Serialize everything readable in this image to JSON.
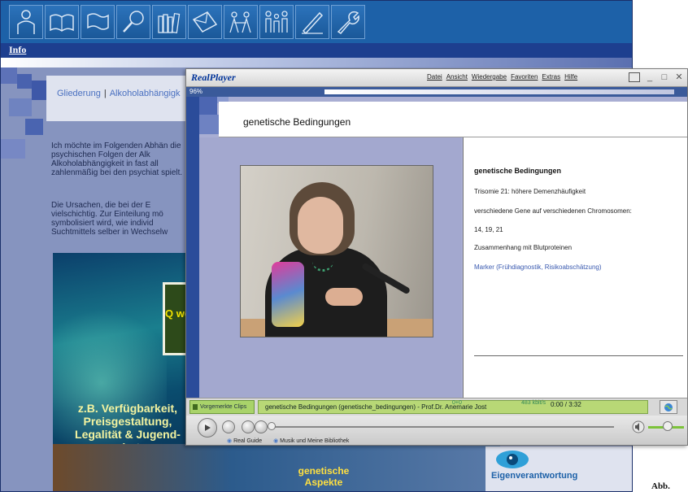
{
  "site": {
    "nav_link": "Info",
    "toolbar_icons": [
      "person-icon",
      "book-icon",
      "flag-icon",
      "magnifier-icon",
      "books-icon",
      "envelope-icon",
      "people-group-icon",
      "family-icon",
      "pen-icon",
      "wrench-icon"
    ],
    "breadcrumb": [
      "Gliederung",
      "Alkoholabhängigk"
    ],
    "paragraph1": "Ich möchte im Folgenden Abhän die psychischen Folgen der Alk Alkoholabhängigkeit in fast all zahlenmäßig bei den psychiat spielt.",
    "paragraph2": "Die Ursachen, die bei der E vielschichtig. Zur Einteilung mö symbolisiert wird, wie individ Suchtmittels selber in Wechselw",
    "image_caption": "z.B. Verfügbarkeit, Preisgestaltung, Legalität & Jugend-schutz",
    "image_box_text": "Q weis",
    "genetic_caption": "genetische Aspekte",
    "right_panel_label": "Eigenverantwortung",
    "figure_label": "Abb."
  },
  "player": {
    "logo": "RealPlayer",
    "menu": [
      "Datei",
      "Ansicht",
      "Wiedergabe",
      "Favoriten",
      "Extras",
      "Hilfe"
    ],
    "zoom": "96%",
    "header_title": "genetische Bedingungen",
    "right_panel": {
      "title": "genetische Bedingungen",
      "lines": [
        "Trisomie 21: höhere Demenzhäufigkeit",
        "verschiedene Gene auf verschiedenen Chromosomen:",
        "14, 19, 21",
        "Zusammenhang mit Blutproteinen"
      ],
      "link": "Marker (Frühdiagnostik, Risikoabschätzung)"
    },
    "clips_button": "Vorgemerkte Clips",
    "clip_title": "genetische Bedingungen (genetische_bedingungen) - Prof.Dr. Anemarie Jost",
    "clip_status": "0+0",
    "clip_rate": "483 kbit/s",
    "clip_time": "0:00 / 3:32",
    "bottom_links": [
      "Real Guide",
      "Musik und Meine Bibliothek"
    ],
    "accent_color": "#7cc33a",
    "brand_color": "#003399"
  }
}
